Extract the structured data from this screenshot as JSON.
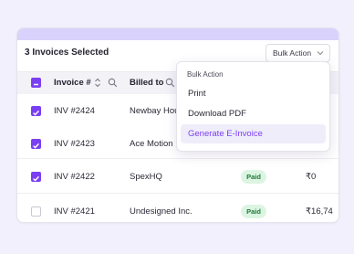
{
  "toolbar": {
    "selection_label": "3 Invoices Selected",
    "bulk_action_label": "Bulk Action"
  },
  "table": {
    "headers": {
      "invoice": "Invoice #",
      "billed_to": "Billed to"
    },
    "rows": [
      {
        "invoice": "INV #2424",
        "billed_to": "Newbay Hou",
        "status": "",
        "amount": "",
        "selected": true
      },
      {
        "invoice": "INV #2423",
        "billed_to": "Ace Motion :",
        "status": "",
        "amount": "",
        "selected": true
      },
      {
        "invoice": "INV #2422",
        "billed_to": "SpexHQ",
        "status": "Paid",
        "amount": "₹0",
        "selected": true
      },
      {
        "invoice": "INV #2421",
        "billed_to": "Undesigned Inc.",
        "status": "Paid",
        "amount": "₹16,74",
        "selected": false
      }
    ]
  },
  "dropdown": {
    "header": "Bulk Action",
    "items": [
      {
        "label": "Print",
        "active": false
      },
      {
        "label": "Download PDF",
        "active": false
      },
      {
        "label": "Generate E-Invoice",
        "active": true
      }
    ]
  },
  "colors": {
    "accent": "#7b3ff2",
    "topbar": "#d9d2fc",
    "paid_badge_bg": "#dcf5e2",
    "paid_badge_text": "#1f7a3a"
  }
}
